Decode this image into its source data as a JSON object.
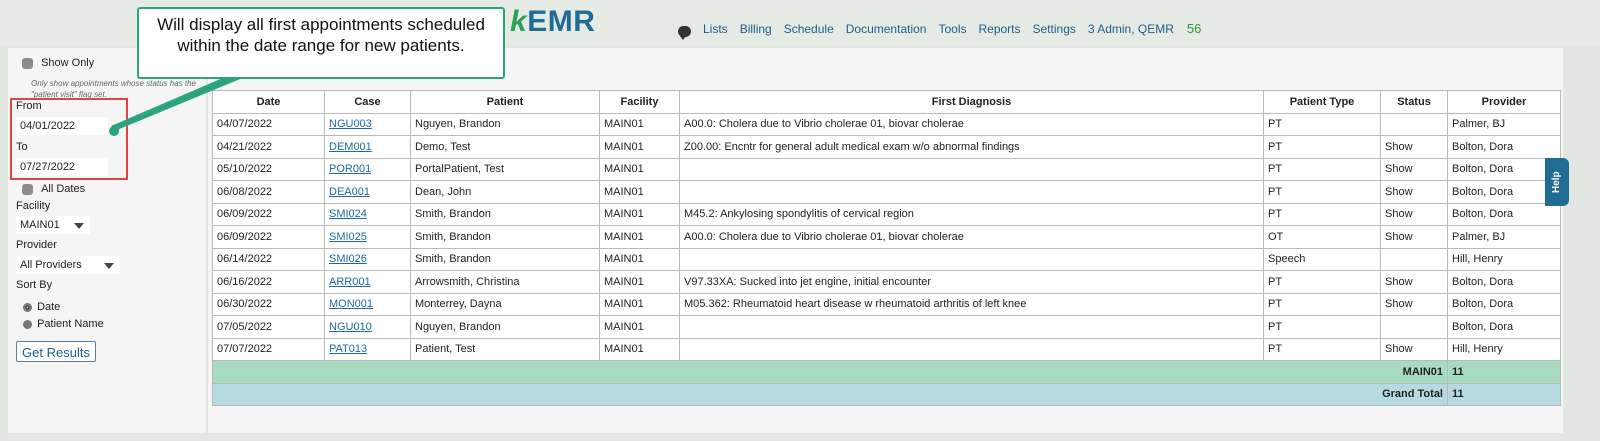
{
  "app": {
    "logo_prefix": "k",
    "logo_main": "EMR",
    "nav": [
      "Lists",
      "Billing",
      "Schedule",
      "Documentation",
      "Tools",
      "Reports",
      "Settings",
      "3 Admin, QEMR"
    ],
    "nav_count": "56",
    "help_label": "Help"
  },
  "callout": {
    "text": "Will display all first appointments scheduled within the date range for new patients."
  },
  "filters": {
    "show_only_label": "Show Only",
    "show_only_hint": "Only show appointments whose status has the \"patient visit\" flag set.",
    "from_label": "From",
    "from_value": "04/01/2022",
    "to_label": "To",
    "to_value": "07/27/2022",
    "all_dates_label": "All Dates",
    "facility_label": "Facility",
    "facility_value": "MAIN01",
    "provider_label": "Provider",
    "provider_value": "All Providers",
    "sort_label": "Sort By",
    "sort_options": [
      "Date",
      "Patient Name"
    ],
    "sort_selected": "Date",
    "submit_label": "Get Results"
  },
  "table": {
    "headers": [
      "Date",
      "Case",
      "Patient",
      "Facility",
      "First Diagnosis",
      "Patient Type",
      "Status",
      "Provider"
    ],
    "rows": [
      [
        "04/07/2022",
        "NGU003",
        "Nguyen, Brandon",
        "MAIN01",
        "A00.0: Cholera due to Vibrio cholerae 01, biovar cholerae",
        "PT",
        "",
        "Palmer, BJ"
      ],
      [
        "04/21/2022",
        "DEM001",
        "Demo, Test",
        "MAIN01",
        "Z00.00: Encntr for general adult medical exam w/o abnormal findings",
        "PT",
        "Show",
        "Bolton, Dora"
      ],
      [
        "05/10/2022",
        "POR001",
        "PortalPatient, Test",
        "MAIN01",
        "",
        "PT",
        "Show",
        "Bolton, Dora"
      ],
      [
        "06/08/2022",
        "DEA001",
        "Dean, John",
        "MAIN01",
        "",
        "PT",
        "Show",
        "Bolton, Dora"
      ],
      [
        "06/09/2022",
        "SMI024",
        "Smith, Brandon",
        "MAIN01",
        "M45.2: Ankylosing spondylitis of cervical region",
        "PT",
        "Show",
        "Bolton, Dora"
      ],
      [
        "06/09/2022",
        "SMI025",
        "Smith, Brandon",
        "MAIN01",
        "A00.0: Cholera due to Vibrio cholerae 01, biovar cholerae",
        "OT",
        "Show",
        "Palmer, BJ"
      ],
      [
        "06/14/2022",
        "SMI026",
        "Smith, Brandon",
        "MAIN01",
        "",
        "Speech",
        "",
        "Hill, Henry"
      ],
      [
        "06/16/2022",
        "ARR001",
        "Arrowsmith, Christina",
        "MAIN01",
        "V97.33XA: Sucked into jet engine, initial encounter",
        "PT",
        "Show",
        "Bolton, Dora"
      ],
      [
        "06/30/2022",
        "MON001",
        "Monterrey, Dayna",
        "MAIN01",
        "M05.362: Rheumatoid heart disease w rheumatoid arthritis of left knee",
        "PT",
        "Show",
        "Bolton, Dora"
      ],
      [
        "07/05/2022",
        "NGU010",
        "Nguyen, Brandon",
        "MAIN01",
        "",
        "PT",
        "",
        "Bolton, Dora"
      ],
      [
        "07/07/2022",
        "PAT013",
        "Patient, Test",
        "MAIN01",
        "",
        "PT",
        "Show",
        "Hill, Henry"
      ]
    ],
    "subtotal_label": "MAIN01",
    "subtotal_value": "11",
    "grand_label": "Grand Total",
    "grand_value": "11"
  }
}
